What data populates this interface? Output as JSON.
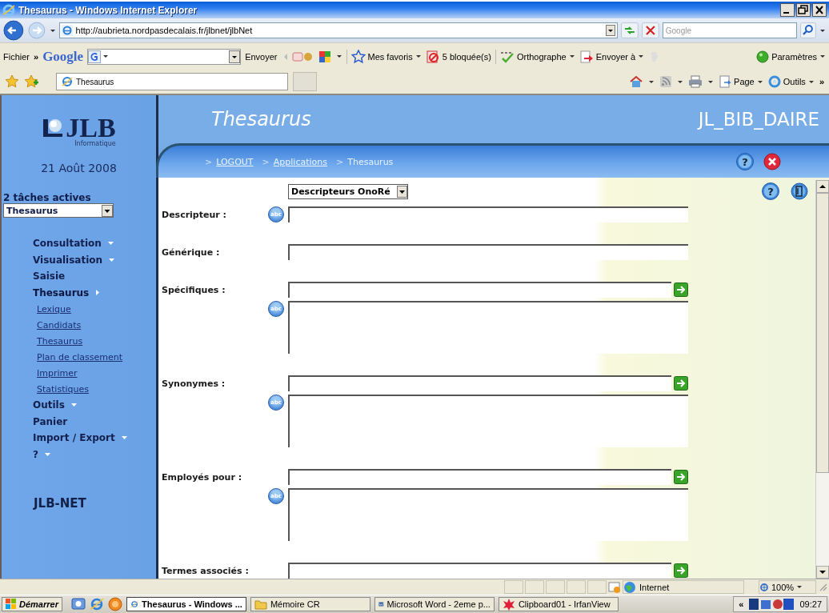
{
  "window": {
    "title": "Thesaurus - Windows Internet Explorer"
  },
  "address_bar": {
    "url": "http://aubrieta.nordpasdecalais.fr/jlbnet/jlbNet",
    "search_placeholder": "Google"
  },
  "toolbar": {
    "menu": "Fichier",
    "chevron": "»",
    "google_logo": "Google",
    "send": "Envoyer",
    "items": [
      {
        "label": "Mes favoris",
        "kind": "star",
        "dropdown": true
      },
      {
        "label": "5 bloquée(s)",
        "kind": "blocked",
        "dropdown": false
      },
      {
        "label": "Orthographe",
        "kind": "spell",
        "dropdown": true
      },
      {
        "label": "Envoyer à",
        "kind": "send",
        "dropdown": true
      }
    ],
    "settings": "Paramètres"
  },
  "tab_row": {
    "tabs": [
      {
        "label": "Thesaurus",
        "selected": true
      }
    ],
    "commands": [
      "Page",
      "Outils"
    ],
    "chevron": "»"
  },
  "sidebar": {
    "logo": "JLB",
    "logo_sub": "Informatique",
    "date": "21 Août 2008",
    "tasks_label": "2 tâches actives",
    "tasks_value": "Thesaurus",
    "menu": [
      {
        "label": "Consultation",
        "submenu": true,
        "expanded": false
      },
      {
        "label": "Visualisation",
        "submenu": true,
        "expanded": false
      },
      {
        "label": "Saisie",
        "submenu": false,
        "expanded": false
      },
      {
        "label": "Thesaurus",
        "submenu": true,
        "expanded": true,
        "children": [
          {
            "label": "Lexique"
          },
          {
            "label": "Candidats"
          },
          {
            "label": "Thesaurus"
          },
          {
            "label": "Plan de classement"
          },
          {
            "label": "Imprimer"
          },
          {
            "label": "Statistiques"
          }
        ]
      },
      {
        "label": "Outils",
        "submenu": true,
        "expanded": false
      },
      {
        "label": "Panier",
        "submenu": false,
        "expanded": false
      },
      {
        "label": "Import / Export",
        "submenu": true,
        "expanded": false
      },
      {
        "label": "?",
        "submenu": true,
        "expanded": false
      }
    ],
    "footer": "JLB-NET"
  },
  "header": {
    "title": "Thesaurus",
    "user": "JL_BIB_DAIRE",
    "breadcrumb": [
      {
        "prefix": ">",
        "label": "LOGOUT",
        "link": true
      },
      {
        "prefix": ">",
        "label": "Applications",
        "link": true
      },
      {
        "prefix": ">",
        "label": "Thesaurus",
        "link": false
      }
    ],
    "help": "?"
  },
  "form": {
    "descriptor_type": "Descripteurs OnoRé",
    "help": "?",
    "fields": [
      {
        "label": "Descripteur :",
        "kind": "input",
        "spell_glyph": "abc"
      },
      {
        "label": "Générique :",
        "kind": "input"
      },
      {
        "label": "Spécifiques :",
        "kind": "list",
        "spell_glyph": "abc"
      },
      {
        "label": "Synonymes :",
        "kind": "list",
        "spell_glyph": "abc"
      },
      {
        "label": "Employés pour :",
        "kind": "list",
        "spell_glyph": "abc"
      },
      {
        "label": "Termes associés :",
        "kind": "input_add"
      }
    ]
  },
  "status_bar": {
    "zone": "Internet",
    "zoom": "100%"
  },
  "taskbar": {
    "start": "Démarrer",
    "tasks": [
      {
        "label": "Thesaurus - Windows ...",
        "kind": "ie",
        "selected": true
      },
      {
        "label": "Mémoire CR",
        "kind": "folder",
        "selected": false
      },
      {
        "label": "Microsoft Word - 2eme p...",
        "kind": "word",
        "selected": false
      },
      {
        "label": "Clipboard01 - IrfanView",
        "kind": "irfan",
        "selected": false
      }
    ],
    "tray_chevron": "«",
    "clock": "09:27"
  }
}
